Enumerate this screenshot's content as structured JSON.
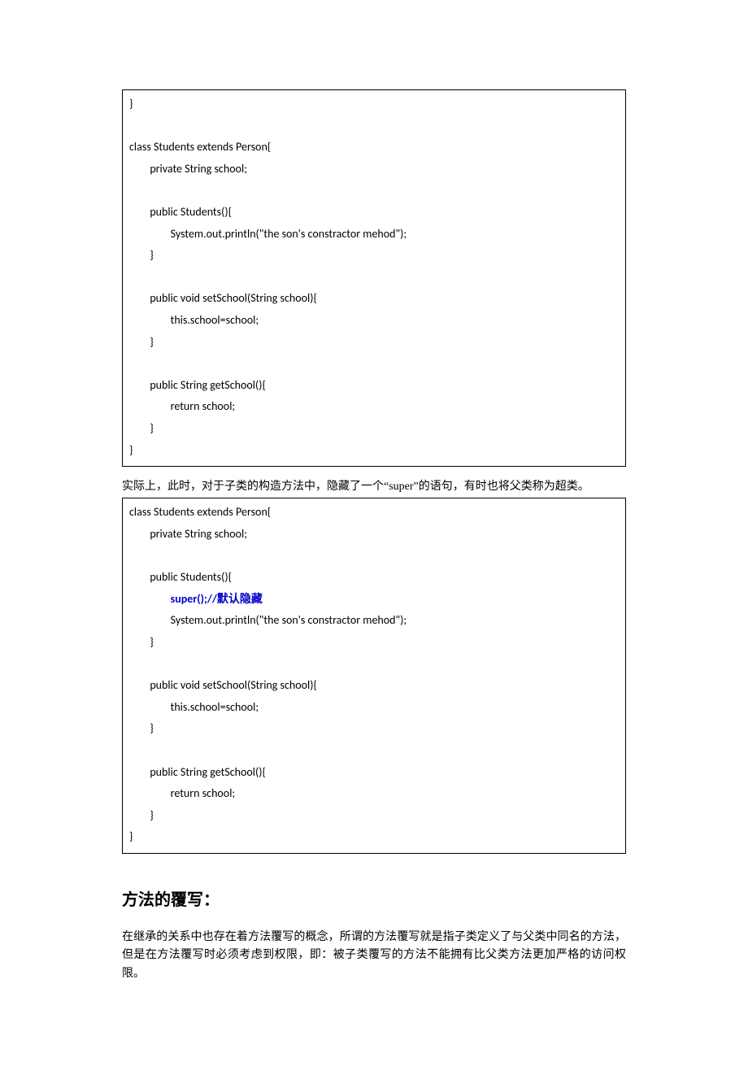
{
  "code1": {
    "l1": "}",
    "l2": "",
    "l3": "class Students extends Person{",
    "l4": "        private String school;",
    "l5": "",
    "l6": "        public Students(){",
    "l7": "                System.out.println(\"the son's constractor mehod\");",
    "l8": "        }",
    "l9": "",
    "l10": "        public void setSchool(String school){",
    "l11": "                this.school=school;",
    "l12": "        }",
    "l13": "",
    "l14": "        public String getSchool(){",
    "l15": "                return school;",
    "l16": "        }",
    "l17": "}"
  },
  "para1": "实际上，此时，对于子类的构造方法中，隐藏了一个“super”的语句，有时也将父类称为超类。",
  "code2": {
    "l1": "class Students extends Person{",
    "l2": "        private String school;",
    "l3": "",
    "l4": "        public Students(){",
    "l5a": "                ",
    "l5b": "super();//默认隐藏",
    "l6": "                System.out.println(\"the son's constractor mehod\");",
    "l7": "        }",
    "l8": "",
    "l9": "        public void setSchool(String school){",
    "l10": "                this.school=school;",
    "l11": "        }",
    "l12": "",
    "l13": "        public String getSchool(){",
    "l14": "                return school;",
    "l15": "        }",
    "l16": "}"
  },
  "heading": "方法的覆写：",
  "para2": "在继承的关系中也存在着方法覆写的概念，所谓的方法覆写就是指子类定义了与父类中同名的方法，但是在方法覆写时必须考虑到权限，即：被子类覆写的方法不能拥有比父类方法更加严格的访问权限。"
}
